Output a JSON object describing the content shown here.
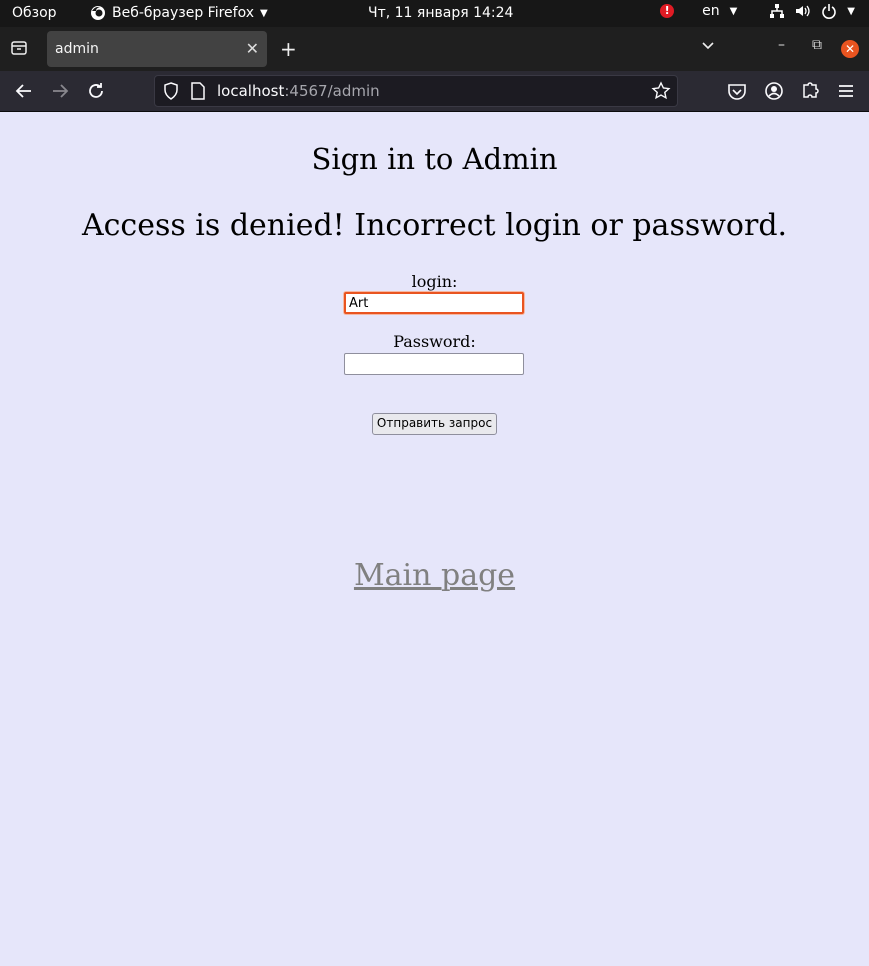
{
  "system_bar": {
    "activities": "Обзор",
    "app_name": "Веб-браузер Firefox",
    "clock": "Чт, 11 января  14:24",
    "alert_glyph": "!",
    "keyboard_layout": "en"
  },
  "browser": {
    "tab_title": "admin",
    "url_host": "localhost",
    "url_rest": ":4567/admin"
  },
  "page": {
    "title": "Sign in to Admin",
    "error": "Access is denied! Incorrect login or password.",
    "login_label": "login:",
    "login_value": "Art",
    "password_label": "Password:",
    "password_value": "",
    "submit_label": "Отправить запрос",
    "main_link": "Main page"
  },
  "colors": {
    "page_background": "#e6e6fa",
    "focus_ring": "#e95420",
    "link": "#808080"
  }
}
